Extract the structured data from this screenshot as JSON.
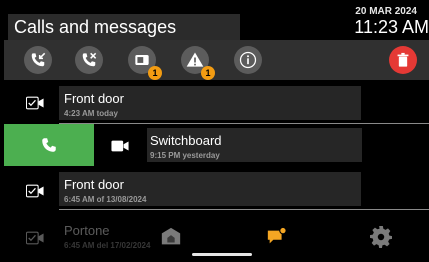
{
  "header": {
    "title": "Calls and messages",
    "date": "20 MAR 2024",
    "time": "11:23 AM"
  },
  "toolbar": {
    "filters": [
      {
        "icon": "incoming-call-icon"
      },
      {
        "icon": "missed-call-icon"
      },
      {
        "icon": "video-message-icon",
        "badge": "1"
      },
      {
        "icon": "alert-icon",
        "badge": "1"
      },
      {
        "icon": "info-icon"
      }
    ],
    "delete_icon": "trash-icon"
  },
  "calls": [
    {
      "name": "Front door",
      "time": "4:23 AM today",
      "icon": "video-call-icon"
    },
    {
      "name": "Switchboard",
      "time": "9:15 PM yesterday",
      "icon": "video-camera-icon"
    },
    {
      "name": "Front door",
      "time": "6:45 AM of 13/08/2024",
      "icon": "video-call-icon"
    },
    {
      "name": "Portone",
      "time": "6:45 AM del 17/02/2024",
      "icon": "video-call-icon"
    }
  ],
  "navbar": {
    "items": [
      {
        "icon": "home-icon"
      },
      {
        "icon": "messages-icon"
      },
      {
        "icon": "settings-icon"
      }
    ]
  },
  "colors": {
    "accent": "#f5a623",
    "call_green": "#4caf50",
    "delete_red": "#e53935",
    "badge": "#f39c12"
  }
}
